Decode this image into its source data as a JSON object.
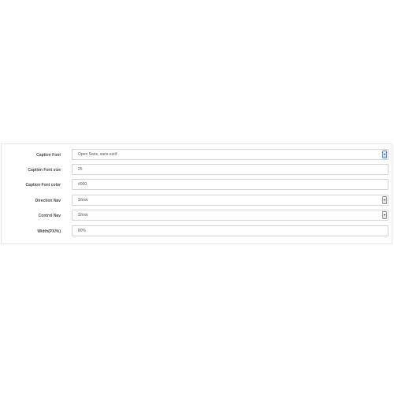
{
  "form": {
    "rows": [
      {
        "label": "Caption Font",
        "value": "Open Sans, sans-serif",
        "type": "select"
      },
      {
        "label": "Caption Font size",
        "value": "25",
        "type": "text"
      },
      {
        "label": "Caption Font color",
        "value": "#000",
        "type": "text"
      },
      {
        "label": "Direction Nav",
        "value": "Show",
        "type": "select"
      },
      {
        "label": "Control Nav",
        "value": "Show",
        "type": "select"
      },
      {
        "label": "Width(PX/%)",
        "value": "80%",
        "type": "text"
      }
    ]
  }
}
